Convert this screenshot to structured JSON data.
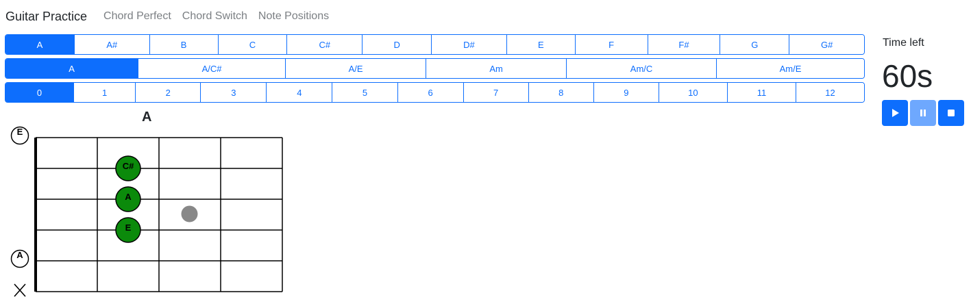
{
  "navbar": {
    "brand": "Guitar Practice",
    "links": [
      "Chord Perfect",
      "Chord Switch",
      "Note Positions"
    ]
  },
  "roots": {
    "items": [
      "A",
      "A#",
      "B",
      "C",
      "C#",
      "D",
      "D#",
      "E",
      "F",
      "F#",
      "G",
      "G#"
    ],
    "selected": "A"
  },
  "chords": {
    "items": [
      "A",
      "A/C#",
      "A/E",
      "Am",
      "Am/C",
      "Am/E"
    ],
    "selected": "A"
  },
  "frets": {
    "items": [
      "0",
      "1",
      "2",
      "3",
      "4",
      "5",
      "6",
      "7",
      "8",
      "9",
      "10",
      "11",
      "12"
    ],
    "selected": "0"
  },
  "timer": {
    "label": "Time left",
    "value": "60s",
    "play_icon": "play-icon",
    "pause_icon": "pause-icon",
    "stop_icon": "stop-icon"
  },
  "chord_diagram": {
    "name": "A",
    "open_string_labels": [
      {
        "label": "E",
        "string_index": 0
      },
      {
        "label": "A",
        "string_index": 4
      }
    ],
    "muted_string_index": 5,
    "muted_icon": "x-icon",
    "notes": [
      {
        "label": "C#",
        "string_index": 1,
        "fret": 2
      },
      {
        "label": "A",
        "string_index": 2,
        "fret": 2
      },
      {
        "label": "E",
        "string_index": 3,
        "fret": 2
      }
    ],
    "marker": {
      "string_index": 2.5,
      "fret": 3
    },
    "colors": {
      "note_fill": "#0b8a0b",
      "marker_fill": "#888888",
      "accent": "#0d6efd"
    }
  }
}
